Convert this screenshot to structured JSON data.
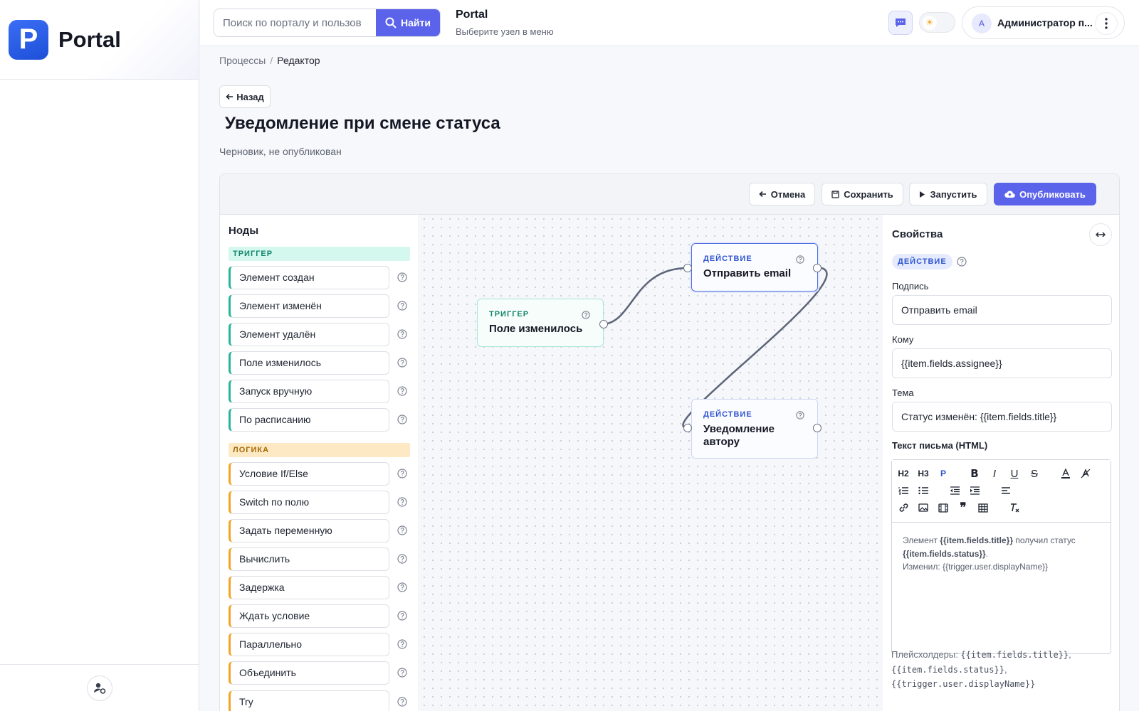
{
  "sidebar": {
    "logo_letter": "P",
    "app_name": "Portal",
    "footer_icon": "user-settings-icon"
  },
  "topbar": {
    "search_placeholder": "Поиск по порталу и пользов",
    "search_button": "Найти",
    "title": "Portal",
    "subtitle": "Выберите узел в меню",
    "chat_icon": "chat-icon",
    "theme_icon": "sun-icon",
    "user_initial": "A",
    "user_name": "Администратор п..."
  },
  "breadcrumb": {
    "items": [
      "Процессы",
      "Редактор"
    ],
    "separator": "/"
  },
  "page": {
    "back_label": "Назад",
    "title": "Уведомление при смене статуса",
    "subtitle": "Черновик, не опубликован"
  },
  "toolbar": {
    "cancel": "Отмена",
    "save": "Сохранить",
    "run": "Запустить",
    "publish": "Опубликовать"
  },
  "palette": {
    "title": "Ноды",
    "sections": [
      {
        "name": "ТРИГГЕР",
        "items": [
          "Элемент создан",
          "Элемент изменён",
          "Элемент удалён",
          "Поле изменилось",
          "Запуск вручную",
          "По расписанию"
        ]
      },
      {
        "name": "ЛОГИКА",
        "items": [
          "Условие If/Else",
          "Switch по полю",
          "Задать переменную",
          "Вычислить",
          "Задержка",
          "Ждать условие",
          "Параллельно",
          "Объединить",
          "Try"
        ]
      }
    ]
  },
  "canvas": {
    "nodes": [
      {
        "kind": "ТРИГГЕР",
        "label": "Поле изменилось"
      },
      {
        "kind": "ДЕЙСТВИЕ",
        "label": "Отправить email"
      },
      {
        "kind": "ДЕЙСТВИЕ",
        "label": "Уведомление автору"
      }
    ]
  },
  "properties": {
    "title": "Свойства",
    "badge": "ДЕЙСТВИЕ",
    "fields": [
      {
        "label": "Подпись",
        "value": "Отправить email"
      },
      {
        "label": "Кому",
        "value": "{{item.fields.assignee}}"
      },
      {
        "label": "Тема",
        "value": "Статус изменён: {{item.fields.title}}"
      }
    ],
    "body_label": "Текст письма (HTML)",
    "editor_buttons": {
      "h2": "H2",
      "h3": "H3",
      "p": "P"
    },
    "body": {
      "p1_a": "Элемент ",
      "p1_b": "{{item.fields.title}}",
      "p1_c": " получил статус ",
      "p1_d": "{{item.fields.status}}",
      "p1_e": ".",
      "p2": "Изменил: {{trigger.user.displayName}}"
    },
    "hint_prefix": "Плейсхолдеры: ",
    "placeholders": [
      "{{item.fields.title}}",
      "{{item.fields.status}}",
      "{{trigger.user.displayName}}"
    ]
  }
}
